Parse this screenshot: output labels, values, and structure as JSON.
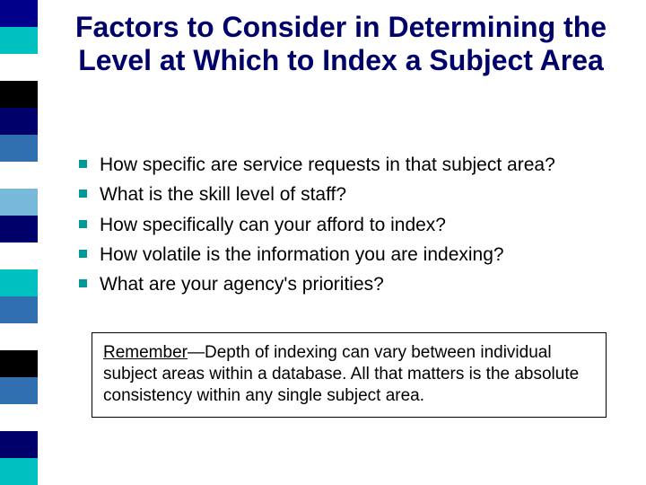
{
  "stripes": [
    "#00008a",
    "#00c0c0",
    "#ffffff",
    "#000000",
    "#00006a",
    "#3070b0",
    "#ffffff",
    "#78b8d8",
    "#00006a",
    "#ffffff",
    "#00c0c0",
    "#3070b0",
    "#ffffff",
    "#000000",
    "#3070b0",
    "#ffffff",
    "#00006a",
    "#00c0c0"
  ],
  "title": "Factors to Consider in Determining the Level at Which to Index a Subject Area",
  "bullets": [
    "How specific are service requests in that subject area?",
    "What is the skill level of staff?",
    "How specifically can your afford to index?",
    "How volatile is the information you are indexing?",
    "What are your agency's priorities?"
  ],
  "note": {
    "lead": "Remember",
    "rest": "—Depth of indexing can vary between individual subject areas within a database.  All that matters is the absolute consistency within any single subject area."
  }
}
